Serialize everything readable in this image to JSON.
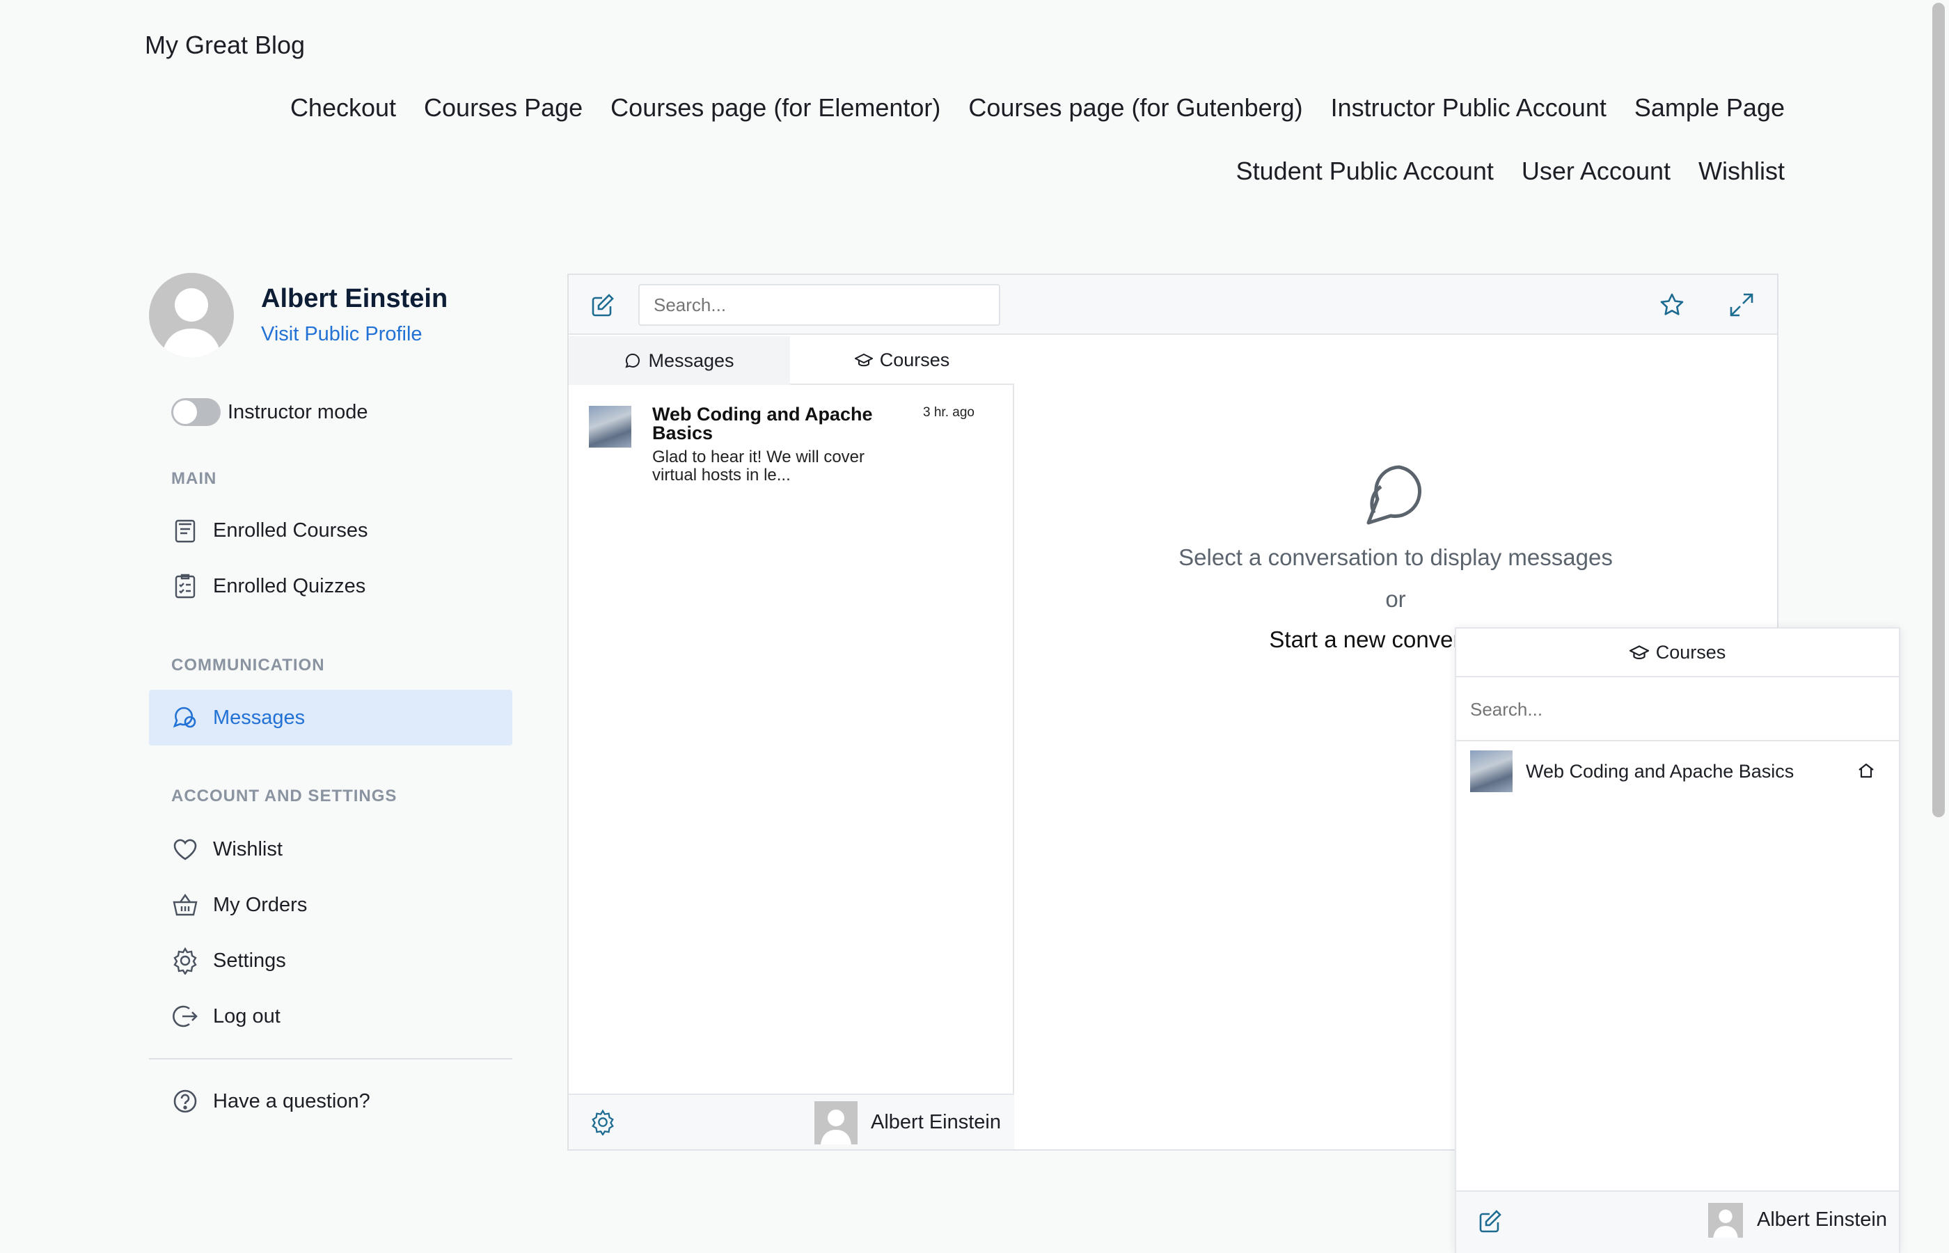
{
  "site": {
    "title": "My Great Blog"
  },
  "nav": {
    "row1": [
      "Checkout",
      "Courses Page",
      "Courses page (for Elementor)",
      "Courses page (for Gutenberg)",
      "Instructor Public Account",
      "Sample Page"
    ],
    "row2": [
      "Student Public Account",
      "User Account",
      "Wishlist"
    ]
  },
  "profile": {
    "name": "Albert Einstein",
    "link": "Visit Public Profile",
    "instructor_mode_label": "Instructor mode",
    "instructor_mode_on": false
  },
  "sidebar": {
    "main_heading": "MAIN",
    "main_items": [
      {
        "label": "Enrolled Courses",
        "icon": "course-book-icon"
      },
      {
        "label": "Enrolled Quizzes",
        "icon": "quiz-checklist-icon"
      }
    ],
    "communication_heading": "COMMUNICATION",
    "communication_items": [
      {
        "label": "Messages",
        "icon": "chat-bubbles-icon",
        "active": true
      }
    ],
    "account_heading": "ACCOUNT AND SETTINGS",
    "account_items": [
      {
        "label": "Wishlist",
        "icon": "heart-icon"
      },
      {
        "label": "My Orders",
        "icon": "basket-icon"
      },
      {
        "label": "Settings",
        "icon": "gear-icon"
      },
      {
        "label": "Log out",
        "icon": "logout-icon"
      }
    ],
    "help": {
      "label": "Have a question?",
      "icon": "question-circle-icon"
    }
  },
  "messages": {
    "search_placeholder": "Search...",
    "tabs": [
      {
        "label": "Messages",
        "icon": "chat-icon"
      },
      {
        "label": "Courses",
        "icon": "graduation-cap-icon"
      }
    ],
    "conversations": [
      {
        "title": "Web Coding and Apache Basics",
        "time": "3 hr. ago",
        "snippet": "Glad to hear it! We will cover virtual hosts in le..."
      }
    ],
    "footer_user": "Albert Einstein",
    "empty": {
      "line1": "Select a conversation to display messages",
      "or": "or",
      "start": "Start a new conversation"
    }
  },
  "courses_popup": {
    "header": "Courses",
    "search_placeholder": "Search...",
    "items": [
      {
        "label": "Web Coding and Apache Basics",
        "icon": "home-icon"
      }
    ],
    "footer_user": "Albert Einstein"
  },
  "colors": {
    "accent": "#2271d4",
    "icon_teal": "#1e6b92",
    "active_bg": "#dfebfb"
  }
}
